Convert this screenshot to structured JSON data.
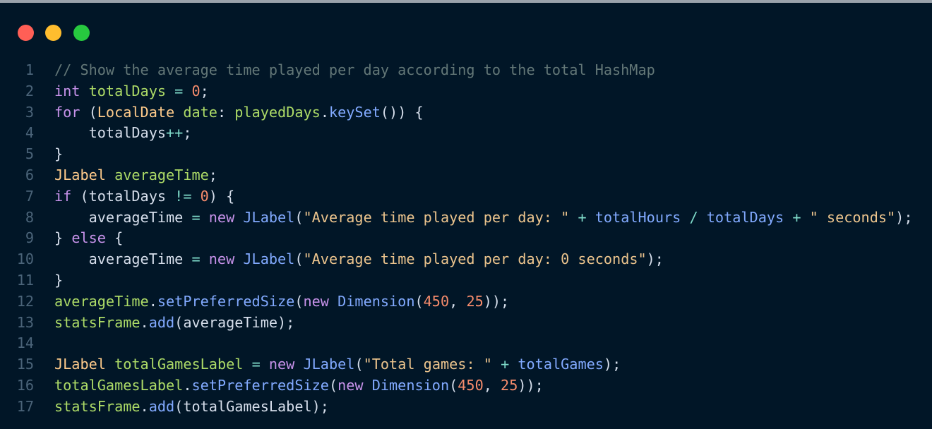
{
  "window": {
    "controls": [
      "close",
      "minimize",
      "maximize"
    ],
    "colors": {
      "background": "#011627",
      "close": "#ff5f56",
      "minimize": "#ffbd2e",
      "maximize": "#27c93f"
    }
  },
  "editor": {
    "language": "java",
    "lines": [
      {
        "n": "1",
        "tokens": [
          {
            "t": "// Show the average time played per day according to the total HashMap",
            "k": "comment"
          }
        ]
      },
      {
        "n": "2",
        "tokens": [
          {
            "t": "int",
            "k": "kw"
          },
          {
            "t": " ",
            "k": "plain"
          },
          {
            "t": "totalDays",
            "k": "var"
          },
          {
            "t": " ",
            "k": "plain"
          },
          {
            "t": "=",
            "k": "op"
          },
          {
            "t": " ",
            "k": "plain"
          },
          {
            "t": "0",
            "k": "num"
          },
          {
            "t": ";",
            "k": "punct"
          }
        ]
      },
      {
        "n": "3",
        "tokens": [
          {
            "t": "for",
            "k": "kw"
          },
          {
            "t": " (",
            "k": "punct"
          },
          {
            "t": "LocalDate",
            "k": "type"
          },
          {
            "t": " ",
            "k": "plain"
          },
          {
            "t": "date",
            "k": "var"
          },
          {
            "t": ": ",
            "k": "punct"
          },
          {
            "t": "playedDays",
            "k": "var"
          },
          {
            "t": ".",
            "k": "punct"
          },
          {
            "t": "keySet",
            "k": "fn"
          },
          {
            "t": "()) {",
            "k": "punct"
          }
        ]
      },
      {
        "n": "4",
        "tokens": [
          {
            "t": "    totalDays",
            "k": "plain"
          },
          {
            "t": "++",
            "k": "op"
          },
          {
            "t": ";",
            "k": "punct"
          }
        ]
      },
      {
        "n": "5",
        "tokens": [
          {
            "t": "}",
            "k": "punct"
          }
        ]
      },
      {
        "n": "6",
        "tokens": [
          {
            "t": "JLabel",
            "k": "type"
          },
          {
            "t": " ",
            "k": "plain"
          },
          {
            "t": "averageTime",
            "k": "var"
          },
          {
            "t": ";",
            "k": "punct"
          }
        ]
      },
      {
        "n": "7",
        "tokens": [
          {
            "t": "if",
            "k": "kw"
          },
          {
            "t": " (totalDays ",
            "k": "plain"
          },
          {
            "t": "!=",
            "k": "op"
          },
          {
            "t": " ",
            "k": "plain"
          },
          {
            "t": "0",
            "k": "num"
          },
          {
            "t": ") {",
            "k": "punct"
          }
        ]
      },
      {
        "n": "8",
        "tokens": [
          {
            "t": "    averageTime ",
            "k": "plain"
          },
          {
            "t": "=",
            "k": "op"
          },
          {
            "t": " ",
            "k": "plain"
          },
          {
            "t": "new",
            "k": "kw"
          },
          {
            "t": " ",
            "k": "plain"
          },
          {
            "t": "JLabel",
            "k": "fn"
          },
          {
            "t": "(",
            "k": "punct"
          },
          {
            "t": "\"Average time played per day: \"",
            "k": "str"
          },
          {
            "t": " ",
            "k": "plain"
          },
          {
            "t": "+",
            "k": "op"
          },
          {
            "t": " ",
            "k": "plain"
          },
          {
            "t": "totalHours",
            "k": "fn"
          },
          {
            "t": " ",
            "k": "plain"
          },
          {
            "t": "/",
            "k": "op"
          },
          {
            "t": " ",
            "k": "plain"
          },
          {
            "t": "totalDays",
            "k": "fn"
          },
          {
            "t": " ",
            "k": "plain"
          },
          {
            "t": "+",
            "k": "op"
          },
          {
            "t": " ",
            "k": "plain"
          },
          {
            "t": "\" seconds\"",
            "k": "str"
          },
          {
            "t": ");",
            "k": "punct"
          }
        ]
      },
      {
        "n": "9",
        "tokens": [
          {
            "t": "} ",
            "k": "punct"
          },
          {
            "t": "else",
            "k": "kw"
          },
          {
            "t": " {",
            "k": "punct"
          }
        ]
      },
      {
        "n": "10",
        "tokens": [
          {
            "t": "    averageTime ",
            "k": "plain"
          },
          {
            "t": "=",
            "k": "op"
          },
          {
            "t": " ",
            "k": "plain"
          },
          {
            "t": "new",
            "k": "kw"
          },
          {
            "t": " ",
            "k": "plain"
          },
          {
            "t": "JLabel",
            "k": "fn"
          },
          {
            "t": "(",
            "k": "punct"
          },
          {
            "t": "\"Average time played per day: 0 seconds\"",
            "k": "str"
          },
          {
            "t": ");",
            "k": "punct"
          }
        ]
      },
      {
        "n": "11",
        "tokens": [
          {
            "t": "}",
            "k": "punct"
          }
        ]
      },
      {
        "n": "12",
        "tokens": [
          {
            "t": "averageTime",
            "k": "var"
          },
          {
            "t": ".",
            "k": "punct"
          },
          {
            "t": "setPreferredSize",
            "k": "fn"
          },
          {
            "t": "(",
            "k": "punct"
          },
          {
            "t": "new",
            "k": "kw"
          },
          {
            "t": " ",
            "k": "plain"
          },
          {
            "t": "Dimension",
            "k": "fn"
          },
          {
            "t": "(",
            "k": "punct"
          },
          {
            "t": "450",
            "k": "num"
          },
          {
            "t": ", ",
            "k": "punct"
          },
          {
            "t": "25",
            "k": "num"
          },
          {
            "t": "));",
            "k": "punct"
          }
        ]
      },
      {
        "n": "13",
        "tokens": [
          {
            "t": "statsFrame",
            "k": "var"
          },
          {
            "t": ".",
            "k": "punct"
          },
          {
            "t": "add",
            "k": "fn"
          },
          {
            "t": "(averageTime);",
            "k": "punct"
          }
        ]
      },
      {
        "n": "14",
        "tokens": []
      },
      {
        "n": "15",
        "tokens": [
          {
            "t": "JLabel",
            "k": "type"
          },
          {
            "t": " ",
            "k": "plain"
          },
          {
            "t": "totalGamesLabel",
            "k": "var"
          },
          {
            "t": " ",
            "k": "plain"
          },
          {
            "t": "=",
            "k": "op"
          },
          {
            "t": " ",
            "k": "plain"
          },
          {
            "t": "new",
            "k": "kw"
          },
          {
            "t": " ",
            "k": "plain"
          },
          {
            "t": "JLabel",
            "k": "fn"
          },
          {
            "t": "(",
            "k": "punct"
          },
          {
            "t": "\"Total games: \"",
            "k": "str"
          },
          {
            "t": " ",
            "k": "plain"
          },
          {
            "t": "+",
            "k": "op"
          },
          {
            "t": " ",
            "k": "plain"
          },
          {
            "t": "totalGames",
            "k": "fn"
          },
          {
            "t": ");",
            "k": "punct"
          }
        ]
      },
      {
        "n": "16",
        "tokens": [
          {
            "t": "totalGamesLabel",
            "k": "var"
          },
          {
            "t": ".",
            "k": "punct"
          },
          {
            "t": "setPreferredSize",
            "k": "fn"
          },
          {
            "t": "(",
            "k": "punct"
          },
          {
            "t": "new",
            "k": "kw"
          },
          {
            "t": " ",
            "k": "plain"
          },
          {
            "t": "Dimension",
            "k": "fn"
          },
          {
            "t": "(",
            "k": "punct"
          },
          {
            "t": "450",
            "k": "num"
          },
          {
            "t": ", ",
            "k": "punct"
          },
          {
            "t": "25",
            "k": "num"
          },
          {
            "t": "));",
            "k": "punct"
          }
        ]
      },
      {
        "n": "17",
        "tokens": [
          {
            "t": "statsFrame",
            "k": "var"
          },
          {
            "t": ".",
            "k": "punct"
          },
          {
            "t": "add",
            "k": "fn"
          },
          {
            "t": "(totalGamesLabel);",
            "k": "punct"
          }
        ]
      }
    ]
  }
}
